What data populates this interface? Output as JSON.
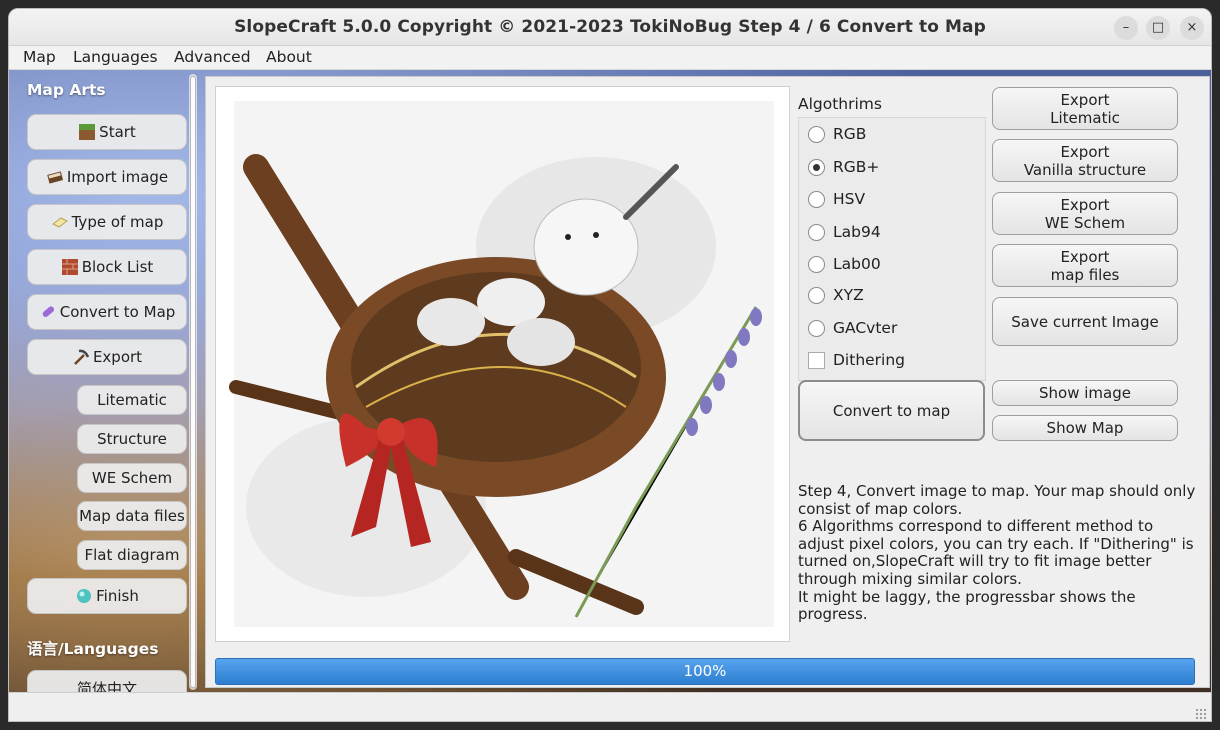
{
  "window": {
    "title": "SlopeCraft 5.0.0 Copyright © 2021-2023 TokiNoBug   Step 4 / 6   Convert to Map",
    "controls": {
      "minimize": "–",
      "maximize": "□",
      "close": "×"
    }
  },
  "menubar": [
    "Map",
    "Languages",
    "Advanced",
    "About"
  ],
  "sidebar": {
    "section_map_arts": "Map Arts",
    "nav": [
      {
        "label": "Start",
        "icon": "grass-block-icon"
      },
      {
        "label": "Import image",
        "icon": "book-icon"
      },
      {
        "label": "Type of map",
        "icon": "map-icon"
      },
      {
        "label": "Block List",
        "icon": "brick-icon"
      },
      {
        "label": "Convert to Map",
        "icon": "potion-icon"
      },
      {
        "label": "Export",
        "icon": "pickaxe-icon"
      }
    ],
    "export_sub": [
      "Litematic",
      "Structure",
      "WE Schem",
      "Map data files",
      "Flat diagram"
    ],
    "finish": {
      "label": "Finish",
      "icon": "diamond-icon"
    },
    "section_languages": "语言/Languages",
    "language_option": "简体中文"
  },
  "algorithms": {
    "label": "Algothrims",
    "options": [
      "RGB",
      "RGB+",
      "HSV",
      "Lab94",
      "Lab00",
      "XYZ",
      "GACvter"
    ],
    "selected": "RGB+",
    "dithering_label": "Dithering",
    "dithering_checked": false
  },
  "buttons": {
    "export_litematic": [
      "Export",
      "Litematic"
    ],
    "export_vanilla": [
      "Export",
      "Vanilla structure"
    ],
    "export_we": [
      "Export",
      "WE Schem"
    ],
    "export_map": [
      "Export",
      "map files"
    ],
    "save_image": "Save current Image",
    "convert": "Convert to map",
    "show_image": "Show image",
    "show_map": "Show Map"
  },
  "description": [
    "Step 4, Convert image to map. Your map should only consist of map colors.",
    "6 Algorithms correspond to different method to adjust pixel colors, you can try each. If \"Dithering\" is turned on,SlopeCraft will try to fit image better through mixing similar colors.",
    "It might be laggy, the progressbar shows the progress."
  ],
  "progress": {
    "value": 100,
    "text": "100%"
  },
  "colors": {
    "progress": "#3d8fe0",
    "accent_bow": "#c8302a",
    "nest": "#6b3f1f"
  }
}
